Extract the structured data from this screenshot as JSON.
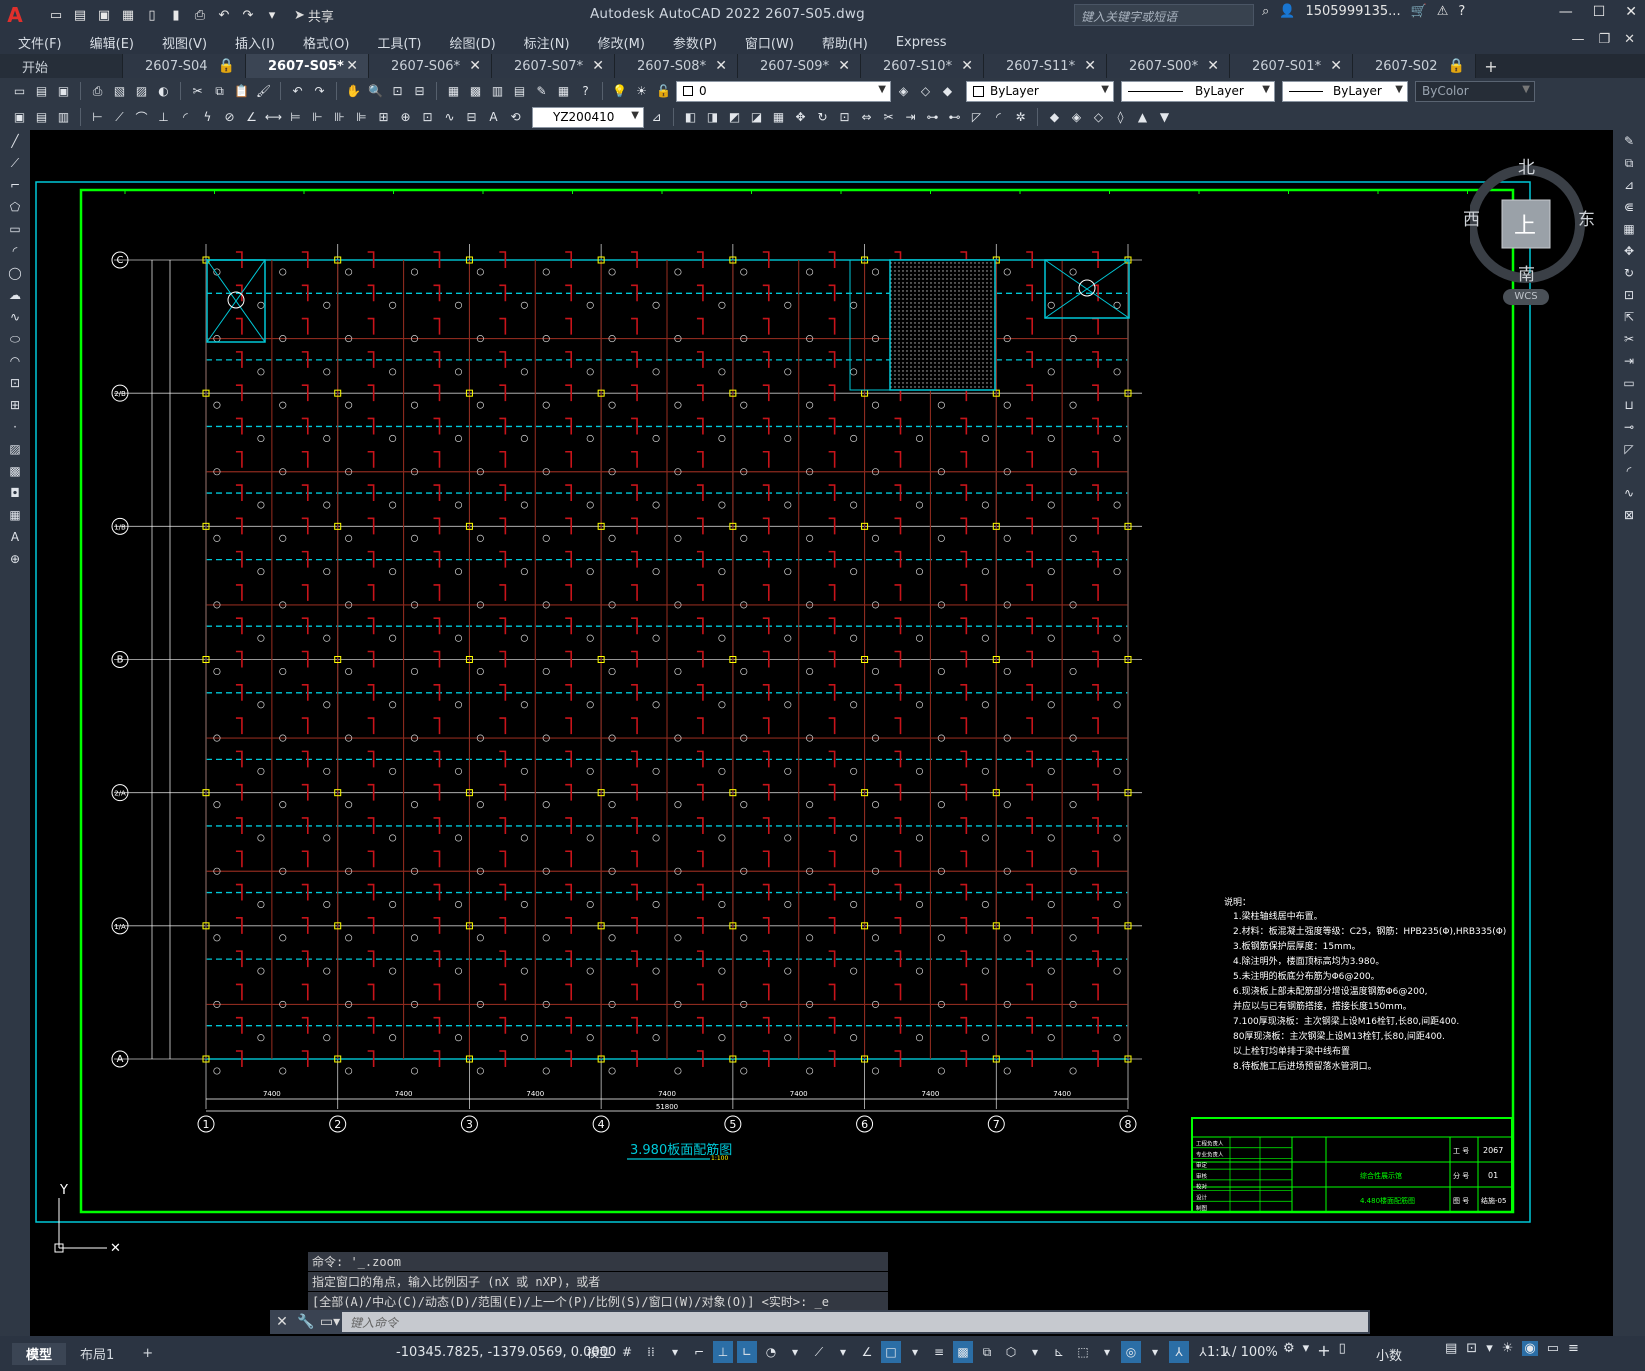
{
  "app": {
    "logo": "A",
    "title": "Autodesk AutoCAD 2022    2607-S05.dwg",
    "share_label": "共享",
    "search_placeholder": "键入关键字或短语",
    "user": "1505999135...",
    "window_controls": [
      "—",
      "☐",
      "✕"
    ]
  },
  "menu": [
    "文件(F)",
    "编辑(E)",
    "视图(V)",
    "插入(I)",
    "格式(O)",
    "工具(T)",
    "绘图(D)",
    "标注(N)",
    "修改(M)",
    "参数(P)",
    "窗口(W)",
    "帮助(H)",
    "Express"
  ],
  "tabs": [
    {
      "label": "开始",
      "closable": false,
      "active": false
    },
    {
      "label": "2607-S04",
      "closable": true,
      "active": false
    },
    {
      "label": "2607-S05*",
      "closable": true,
      "active": true
    },
    {
      "label": "2607-S06*",
      "closable": true,
      "active": false
    },
    {
      "label": "2607-S07*",
      "closable": true,
      "active": false
    },
    {
      "label": "2607-S08*",
      "closable": true,
      "active": false
    },
    {
      "label": "2607-S09*",
      "closable": true,
      "active": false
    },
    {
      "label": "2607-S10*",
      "closable": true,
      "active": false
    },
    {
      "label": "2607-S11*",
      "closable": true,
      "active": false
    },
    {
      "label": "2607-S00*",
      "closable": true,
      "active": false
    },
    {
      "label": "2607-S01*",
      "closable": true,
      "active": false
    },
    {
      "label": "2607-S02",
      "closable": false,
      "active": false
    }
  ],
  "toolbar": {
    "layer_value": "0",
    "color_value": "ByLayer",
    "linetype_value": "ByLayer",
    "lineweight_value": "ByLayer",
    "plotstyle_value": "ByColor",
    "dimstyle_value": "YZ200410"
  },
  "viewcube": {
    "north": "北",
    "south": "南",
    "east": "东",
    "west": "西",
    "top": "上",
    "wcs": "WCS"
  },
  "drawing": {
    "grid_letters": [
      "C",
      "2/B",
      "1/B",
      "B",
      "2/A",
      "1/A",
      "A"
    ],
    "grid_numbers": [
      "1",
      "2",
      "3",
      "4",
      "5",
      "6",
      "7",
      "8"
    ],
    "bay_dims": [
      "7400",
      "7400",
      "7400",
      "7400",
      "7400",
      "7400",
      "7400"
    ],
    "total_dim": "51800",
    "plan_title": "3.980板面配筋图",
    "plan_scale": "1:100",
    "notes_title": "说明：",
    "notes": [
      "1.梁柱轴线居中布置。",
      "2.材料：板混凝土强度等级：C25，钢筋：HPB235(Φ),HRB335(Φ)",
      "3.板钢筋保护层厚度：15mm。",
      "4.除注明外，楼面顶标高均为3.980。",
      "5.未注明的板底分布筋为Φ6@200。",
      "6.现浇板上部未配筋部分增设温度钢筋Φ6@200,",
      "  并应以与已有钢筋搭接，搭接长度150mm。",
      "7.100厚现浇板：主次钢梁上设M16栓钉,长80,间距400.",
      "  80厚现浇板：主次钢梁上设M13栓钉,长80,间距400.",
      "  以上栓钉均单排于梁中线布置",
      "8.待板施工后进场预留落水管洞口。"
    ],
    "titleblock": {
      "project_no_label": "工 号",
      "project_no": "2067",
      "stage_label": "分 号",
      "stage": "01",
      "drawing_no_label": "图 号",
      "drawing_no": "结施-05",
      "drawing_name": "4.480楼面配筋图",
      "project_name": "综合性展示馆",
      "row_labels": [
        "工程负责人",
        "专业负责人",
        "审定",
        "审核",
        "校对",
        "设计",
        "制图"
      ]
    }
  },
  "command": {
    "history": [
      "命令: '_.zoom",
      "指定窗口的角点，输入比例因子 (nX 或 nXP)，或者",
      "[全部(A)/中心(C)/动态(D)/范围(E)/上一个(P)/比例(S)/窗口(W)/对象(O)] <实时>: _e"
    ],
    "placeholder": "键入命令"
  },
  "status": {
    "tabs": [
      "模型",
      "布局1"
    ],
    "coordinates": "-10345.7825, -1379.0569, 0.0000",
    "space": "模型",
    "scale": "1:1 / 100%",
    "units": "小数"
  },
  "colors": {
    "frame_green": "#00ff00",
    "grid_cyan": "#00c8d7",
    "rebar_red": "#c8141a",
    "rebar_dark_red": "#8c2a1e",
    "text_white": "#ffffff",
    "column_yellow": "#ffff00",
    "highlight_blue": "#2b6ea6"
  }
}
